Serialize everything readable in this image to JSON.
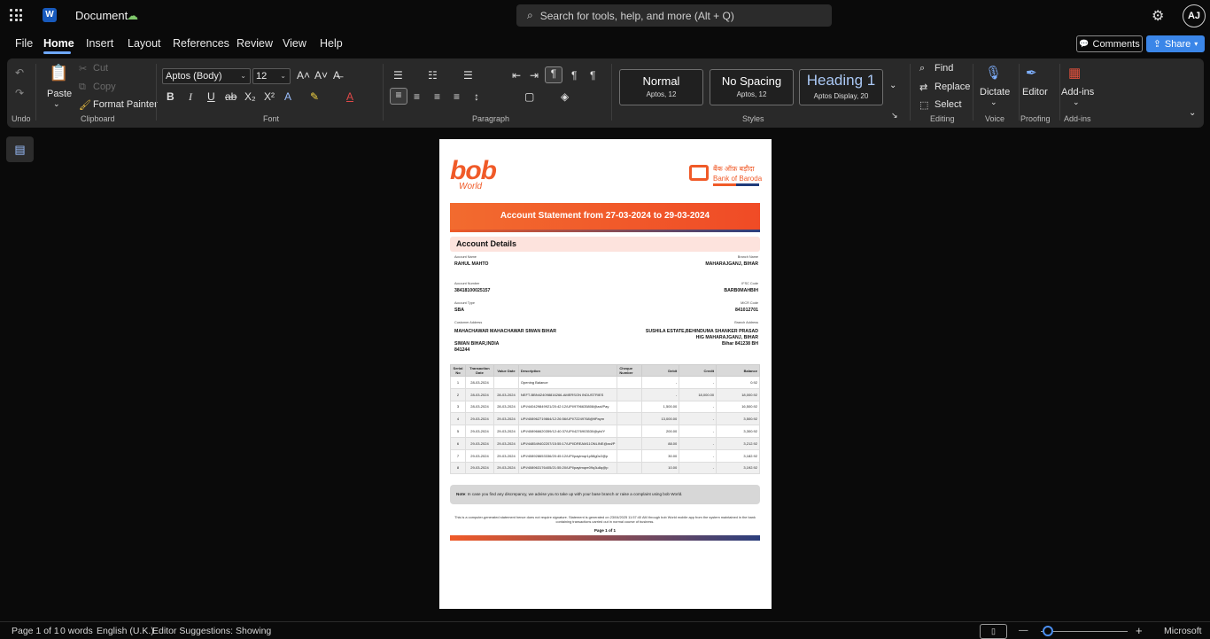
{
  "titlebar": {
    "app_letter": "W",
    "doc_title": "Document",
    "save_glyph": "☁",
    "search_glyph": "⌕",
    "search_placeholder": "Search for tools, help, and more (Alt + Q)",
    "settings_glyph": "⚙",
    "avatar_initials": "AJ"
  },
  "menu": {
    "items": [
      "File",
      "Home",
      "Insert",
      "Layout",
      "References",
      "Review",
      "View",
      "Help"
    ],
    "active": "Home",
    "comments_glyph": "💬",
    "comments_label": "Comments",
    "share_glyph": "⇪",
    "share_label": "Share",
    "share_caret": "▾"
  },
  "ribbon": {
    "undo_glyph": "↶",
    "redo_glyph": "↷",
    "undo_group": "Undo",
    "clipboard": {
      "paste_glyph": "📋",
      "paste": "Paste",
      "paste_caret": "⌄",
      "cut_glyph": "✂",
      "cut": "Cut",
      "copy_glyph": "⧉",
      "copy": "Copy",
      "format_painter_glyph": "🖌",
      "format_painter": "Format Painter",
      "group": "Clipboard"
    },
    "font": {
      "name": "Aptos (Body)",
      "size": "12",
      "dd_glyph": "⌄",
      "grow_glyph": "A˄",
      "shrink_glyph": "A˅",
      "clear_glyph": "A̶",
      "bold_glyph": "B",
      "italic_glyph": "I",
      "underline_glyph": "U",
      "strike_glyph": "ab",
      "subscript_glyph": "X₂",
      "superscript_glyph": "X²",
      "effects_glyph": "A",
      "highlight_glyph": "✎",
      "color_glyph": "A",
      "group": "Font"
    },
    "paragraph": {
      "bullets_glyph": "☰",
      "numbering_glyph": "☷",
      "multilevel_glyph": "☰",
      "outdent_glyph": "⇤",
      "indent_glyph": "⇥",
      "ltr_glyph": "¶",
      "rtl_glyph": "¶",
      "show_marks_glyph": "¶",
      "align_left_glyph": "≡",
      "align_center_glyph": "≡",
      "align_right_glyph": "≡",
      "justify_glyph": "≡",
      "line_spacing_glyph": "↕",
      "borders_glyph": "▢",
      "shading_glyph": "◈",
      "group": "Paragraph"
    },
    "styles": {
      "cards": [
        {
          "name": "Normal",
          "sub": "Aptos, 12"
        },
        {
          "name": "No Spacing",
          "sub": "Aptos, 12"
        },
        {
          "name": "Heading 1",
          "sub": "Aptos Display, 20"
        }
      ],
      "more_glyph": "⌄",
      "launcher_glyph": "↘",
      "group": "Styles"
    },
    "editing": {
      "find_glyph": "⌕",
      "find": "Find",
      "replace_glyph": "⇄",
      "replace": "Replace",
      "select_glyph": "⬚",
      "select": "Select",
      "group": "Editing"
    },
    "voice": {
      "mic_glyph": "🎙",
      "dictate": "Dictate",
      "caret": "⌄",
      "group": "Voice"
    },
    "proofing": {
      "editor_glyph": "✒",
      "editor": "Editor",
      "group": "Proofing"
    },
    "addins": {
      "addins_glyph": "▦",
      "addins": "Add-ins",
      "caret": "⌄",
      "group": "Add-ins"
    },
    "collapse_glyph": "⌄"
  },
  "sidebar": {
    "glyph": "▤"
  },
  "document": {
    "brand_logo": "bob",
    "brand_sub": "World",
    "bank_hindi": "बैंक ऑफ़ बड़ौदा",
    "bank_name": "Bank of Baroda",
    "banner": "Account Statement from 27-03-2024 to 29-03-2024",
    "details_heading": "Account Details",
    "account_name_label": "Account Name",
    "account_name": "RAHUL MAHTO",
    "branch_name_label": "Branch Name",
    "branch_name": "MAHARAJGANJ, BIHAR",
    "account_number_label": "Account Number",
    "account_number": "38418100025157",
    "ifsc_label": "IFSC Code",
    "ifsc": "BARB0MAHBIH",
    "account_type_label": "Account Type",
    "account_type": "SBA",
    "micr_label": "MICR Code",
    "micr": "841012701",
    "customer_address_label": "Customer Address",
    "customer_address_1": "MAHACHAWAR MAHACHAWAR  SIWAN BIHAR",
    "customer_address_2": "SIWAN BIHAR,INDIA",
    "customer_address_3": "841244",
    "branch_address_label": "Branch Address",
    "branch_address_1": "SUSHILA ESTATE,BEHINDUMA SHANKER PRASAD",
    "branch_address_2": "HIG MAHARAJGANJ, BIHAR",
    "branch_address_3": "Bihar 841238 BH",
    "columns": [
      "Serial No",
      "Transaction Date",
      "Value Date",
      "Description",
      "Cheque Number",
      "Debit",
      "Credit",
      "Balance"
    ],
    "rows": [
      [
        "1",
        "28-03-2024",
        "",
        "Opening Balance",
        "",
        "-",
        "-",
        "0.92"
      ],
      [
        "2",
        "28-03-2024",
        "28-03-2024",
        "NEFT-BBN424098816266-AMERSON INDUSTRIES",
        "",
        "-",
        "18,000.00",
        "18,000.92"
      ],
      [
        "3",
        "28-03-2024",
        "28-03-2024",
        "UPI/440429849921/20:42:12/UPI/9796635808@axl/Pay",
        "",
        "1,500.00",
        "-",
        "16,500.92"
      ],
      [
        "4",
        "29-03-2024",
        "29-03-2024",
        "UPI/408962719864/12:26:56/UPI/72249768@fiPaym",
        "",
        "13,000.00",
        "-",
        "3,500.92"
      ],
      [
        "5",
        "29-03-2024",
        "29-03-2024",
        "UPI/408966620359/12:40:37/UPI/4276903530@ybl/Y",
        "",
        "200.00",
        "-",
        "3,300.92"
      ],
      [
        "6",
        "29-03-2024",
        "29-03-2024",
        "UPI/448549402207/15:55:17/UPI/DREAM11ONLINE@axl/P",
        "",
        "88.00",
        "-",
        "3,212.92"
      ],
      [
        "7",
        "29-03-2024",
        "29-03-2024",
        "UPI/408928653336/20:45:12/UPI/paytmqr1p58g0z2@p",
        "",
        "30.00",
        "-",
        "3,182.92"
      ],
      [
        "8",
        "29-03-2024",
        "29-03-2024",
        "UPI/408963176405/21:55:20/UPI/paytmqre09q3u8q@p",
        "",
        "10.00",
        "-",
        "3,192.92"
      ]
    ],
    "note_label": "Note",
    "note_text": ": In case you find any discrepancy, we advise you to take up with your base branch or raise a complaint using bob World.",
    "footer_1": "This is a computer-generated statement hence does not require signature. Statement is generated on 23/04/2025 11:57:40 AM through bob World mobile app from the system maintained in the bank containing transactions carried out in normal course of business.",
    "footer_page": "Page 1 of 1"
  },
  "status": {
    "page": "Page 1 of 1",
    "words": "0 words",
    "language": "English (U.K.)",
    "suggestions": "Editor Suggestions: Showing",
    "view_glyph": "▯",
    "zoom_out_glyph": "—",
    "zoom_in_glyph": "+",
    "brand": "Microsoft"
  },
  "colors": {
    "accent": "#3b86e8",
    "bob_orange": "#f05a28",
    "bob_navy": "#2c3f7d"
  }
}
